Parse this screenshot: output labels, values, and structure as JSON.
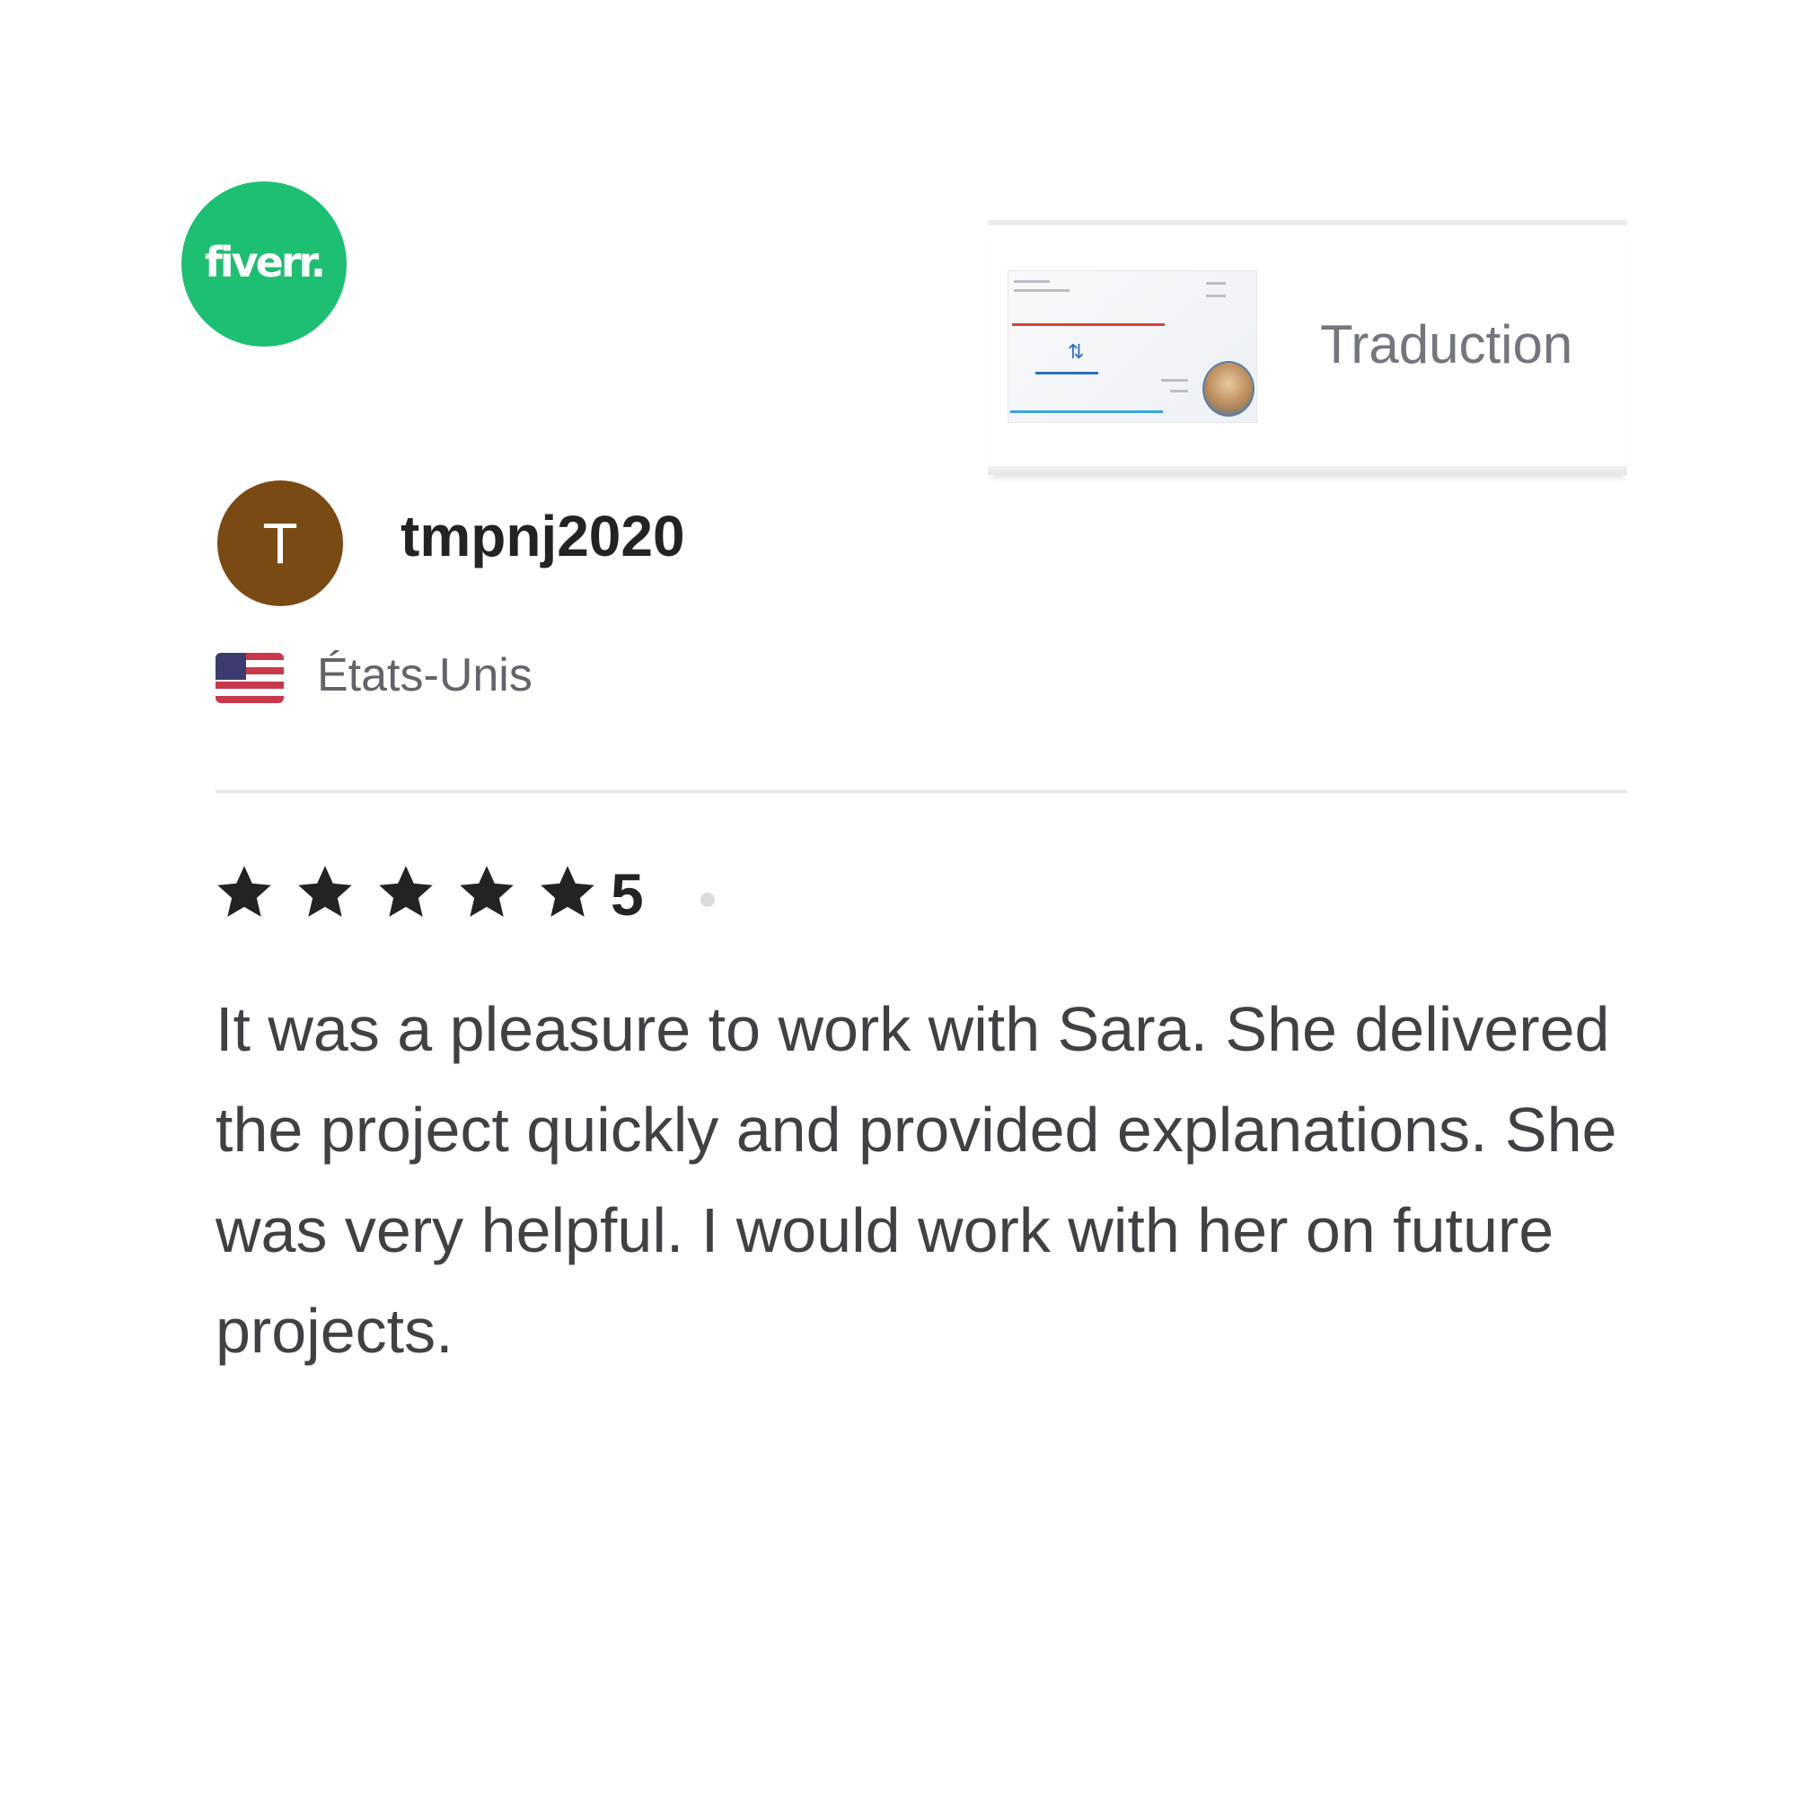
{
  "brand": {
    "logo_text": "fiverr.",
    "color": "#1dbf73"
  },
  "gig": {
    "title": "Traduction"
  },
  "reviewer": {
    "avatar_initial": "T",
    "avatar_color": "#7a4a14",
    "username": "tmpnj2020",
    "country_flag_icon": "us-flag-icon",
    "country": "États-Unis"
  },
  "review": {
    "rating": 5,
    "rating_label": "5",
    "star_icon": "star-icon",
    "star_color": "#222325",
    "text": "It was a pleasure to work with Sara. She delivered the project quickly and provided explanations. She was very helpful. I would work with her on future projects."
  }
}
